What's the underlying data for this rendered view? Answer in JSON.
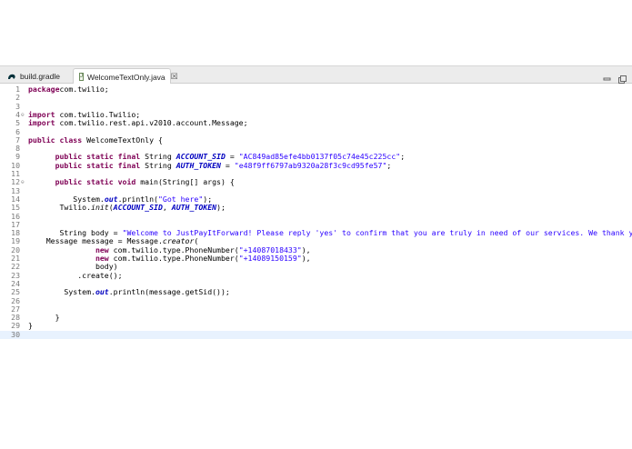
{
  "tabs": [
    {
      "label": "build.gradle",
      "icon": "gradle-icon",
      "active": false
    },
    {
      "label": "WelcomeTextOnly.java",
      "icon": "java-file-icon",
      "active": true,
      "close": "☒"
    }
  ],
  "window_controls": [
    {
      "icon": "minimize-icon"
    },
    {
      "icon": "maximize-icon"
    }
  ],
  "colors": {
    "keyword": "#7f0055",
    "string": "#2a00ff",
    "field": "#0000c0",
    "current_line": "#e8f2fe"
  },
  "code_lines": [
    {
      "n": "1",
      "parts": [
        [
          "kw",
          "package"
        ],
        [
          "",
          "com.twilio;"
        ]
      ]
    },
    {
      "n": "2",
      "parts": []
    },
    {
      "n": "3",
      "parts": []
    },
    {
      "n": "4",
      "fold": true,
      "parts": [
        [
          "kw",
          "import"
        ],
        [
          "",
          " com.twilio.Twilio;"
        ]
      ]
    },
    {
      "n": "5",
      "parts": [
        [
          "kw",
          "import"
        ],
        [
          "",
          " com.twilio.rest.api.v2010.account.Message;"
        ]
      ]
    },
    {
      "n": "6",
      "parts": []
    },
    {
      "n": "7",
      "parts": [
        [
          "kw",
          "public class"
        ],
        [
          "",
          " WelcomeTextOnly {"
        ]
      ]
    },
    {
      "n": "8",
      "parts": []
    },
    {
      "n": "9",
      "parts": [
        [
          "",
          "      "
        ],
        [
          "kw",
          "public static final"
        ],
        [
          "",
          " String "
        ],
        [
          "fld",
          "ACCOUNT_SID"
        ],
        [
          "",
          " = "
        ],
        [
          "str",
          "\"AC849ad85efe4bb0137f05c74e45c225cc\""
        ],
        [
          "",
          ";"
        ]
      ]
    },
    {
      "n": "10",
      "parts": [
        [
          "",
          "      "
        ],
        [
          "kw",
          "public static final"
        ],
        [
          "",
          " String "
        ],
        [
          "fld",
          "AUTH_TOKEN"
        ],
        [
          "",
          " = "
        ],
        [
          "str",
          "\"e48f9ff6797ab9320a28f3c9cd95fe57\""
        ],
        [
          "",
          ";"
        ]
      ]
    },
    {
      "n": "11",
      "parts": []
    },
    {
      "n": "12",
      "fold": true,
      "parts": [
        [
          "",
          "      "
        ],
        [
          "kw",
          "public static void"
        ],
        [
          "",
          " main(String[] args) {"
        ]
      ]
    },
    {
      "n": "13",
      "parts": []
    },
    {
      "n": "14",
      "parts": [
        [
          "",
          "          System."
        ],
        [
          "bold-ital",
          "out"
        ],
        [
          "",
          ".println("
        ],
        [
          "str",
          "\"Got here\""
        ],
        [
          "",
          ");"
        ]
      ]
    },
    {
      "n": "15",
      "parts": [
        [
          "",
          "       Twilio."
        ],
        [
          "ital",
          "init"
        ],
        [
          "",
          "("
        ],
        [
          "fld",
          "ACCOUNT_SID"
        ],
        [
          "",
          ", "
        ],
        [
          "fld",
          "AUTH_TOKEN"
        ],
        [
          "",
          ");"
        ]
      ]
    },
    {
      "n": "16",
      "parts": []
    },
    {
      "n": "17",
      "parts": []
    },
    {
      "n": "18",
      "parts": [
        [
          "",
          "       String body = "
        ],
        [
          "str",
          "\"Welcome to JustPayItForward! Please reply 'yes' to confirm that you are truly in need of our services. We thank you"
        ]
      ]
    },
    {
      "n": "19",
      "parts": [
        [
          "",
          "    Message message = Message."
        ],
        [
          "ital",
          "creator"
        ],
        [
          "",
          "("
        ]
      ]
    },
    {
      "n": "20",
      "parts": [
        [
          "",
          "               "
        ],
        [
          "kw",
          "new"
        ],
        [
          "",
          " com.twilio.type.PhoneNumber("
        ],
        [
          "str",
          "\"+14087018433\""
        ],
        [
          "",
          "),"
        ]
      ]
    },
    {
      "n": "21",
      "parts": [
        [
          "",
          "               "
        ],
        [
          "kw",
          "new"
        ],
        [
          "",
          " com.twilio.type.PhoneNumber("
        ],
        [
          "str",
          "\"+14089150159\""
        ],
        [
          "",
          "),"
        ]
      ]
    },
    {
      "n": "22",
      "parts": [
        [
          "",
          "               body)"
        ]
      ]
    },
    {
      "n": "23",
      "parts": [
        [
          "",
          "           .create();"
        ]
      ]
    },
    {
      "n": "24",
      "parts": []
    },
    {
      "n": "25",
      "parts": [
        [
          "",
          "        System."
        ],
        [
          "bold-ital",
          "out"
        ],
        [
          "",
          ".println(message.getSid());"
        ]
      ]
    },
    {
      "n": "26",
      "parts": []
    },
    {
      "n": "27",
      "parts": []
    },
    {
      "n": "28",
      "parts": [
        [
          "",
          "      }"
        ]
      ]
    },
    {
      "n": "29",
      "parts": [
        [
          "",
          "}"
        ]
      ]
    },
    {
      "n": "30",
      "current": true,
      "parts": []
    }
  ]
}
